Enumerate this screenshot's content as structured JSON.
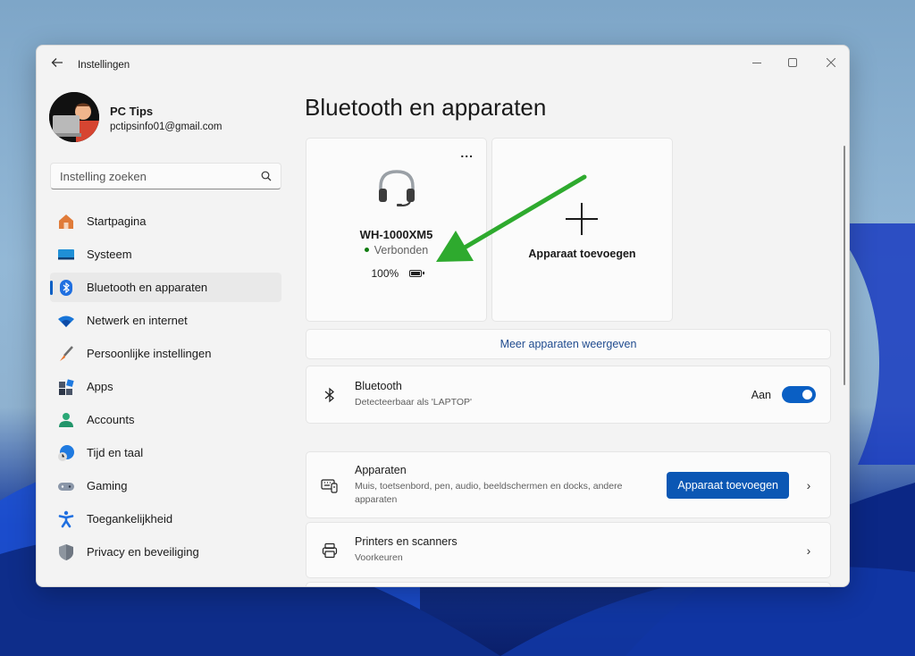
{
  "window": {
    "title": "Instellingen",
    "controls": {
      "minimize": "minimize",
      "maximize": "maximize",
      "close": "close"
    }
  },
  "profile": {
    "name": "PC Tips",
    "email": "pctipsinfo01@gmail.com"
  },
  "search": {
    "placeholder": "Instelling zoeken"
  },
  "sidebar": {
    "items": [
      {
        "label": "Startpagina",
        "icon": "home-icon",
        "active": false
      },
      {
        "label": "Systeem",
        "icon": "system-icon",
        "active": false
      },
      {
        "label": "Bluetooth en apparaten",
        "icon": "bluetooth-icon",
        "active": true
      },
      {
        "label": "Netwerk en internet",
        "icon": "wifi-icon",
        "active": false
      },
      {
        "label": "Persoonlijke instellingen",
        "icon": "brush-icon",
        "active": false
      },
      {
        "label": "Apps",
        "icon": "apps-icon",
        "active": false
      },
      {
        "label": "Accounts",
        "icon": "person-icon",
        "active": false
      },
      {
        "label": "Tijd en taal",
        "icon": "globe-clock-icon",
        "active": false
      },
      {
        "label": "Gaming",
        "icon": "gamepad-icon",
        "active": false
      },
      {
        "label": "Toegankelijkheid",
        "icon": "accessibility-icon",
        "active": false
      },
      {
        "label": "Privacy en beveiliging",
        "icon": "shield-icon",
        "active": false
      }
    ]
  },
  "main": {
    "title": "Bluetooth en apparaten",
    "device_card": {
      "name": "WH-1000XM5",
      "status": "Verbonden",
      "battery": "100%",
      "battery_level": 1.0,
      "more": "..."
    },
    "add_card": {
      "label": "Apparaat toevoegen"
    },
    "more_devices": "Meer apparaten weergeven",
    "bluetooth_row": {
      "title": "Bluetooth",
      "subtitle": "Detecteerbaar als 'LAPTOP'",
      "toggle_label": "Aan",
      "toggle_on": true
    },
    "devices_row": {
      "title": "Apparaten",
      "subtitle": "Muis, toetsenbord, pen, audio, beeldschermen en docks, andere apparaten",
      "button": "Apparaat toevoegen"
    },
    "printers_row": {
      "title": "Printers en scanners",
      "subtitle": "Voorkeuren"
    }
  },
  "colors": {
    "accent": "#0a5fc4",
    "button": "#0b57b4",
    "link": "#1f4b8f",
    "status_connected": "#107c10",
    "annotation_arrow": "#2eaa2e"
  }
}
